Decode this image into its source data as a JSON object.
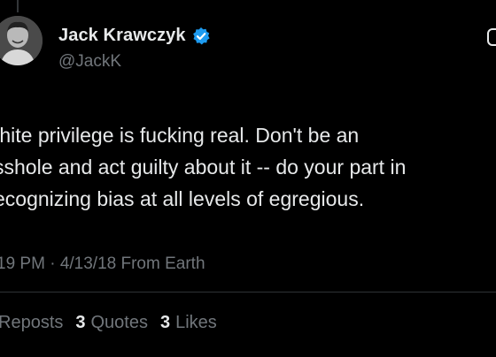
{
  "author": {
    "display_name": "Jack Krawczyk",
    "handle": "@JackK",
    "verified": true,
    "verified_color": "#1d9bf0"
  },
  "tweet": {
    "lines": [
      "/hite privilege is fucking real. Don't be an",
      "sshole and act guilty about it -- do your part in",
      "ecognizing bias at all levels of egregious."
    ]
  },
  "meta": {
    "time": "19 PM",
    "separator": "·",
    "date": "4/13/18",
    "source": "From Earth"
  },
  "stats": {
    "reposts_label": "Reposts",
    "quotes_count": "3",
    "quotes_label": "Quotes",
    "likes_count": "3",
    "likes_label": "Likes"
  },
  "colors": {
    "background": "#000000",
    "primary_text": "#e7e9ea",
    "secondary_text": "#71767b"
  }
}
